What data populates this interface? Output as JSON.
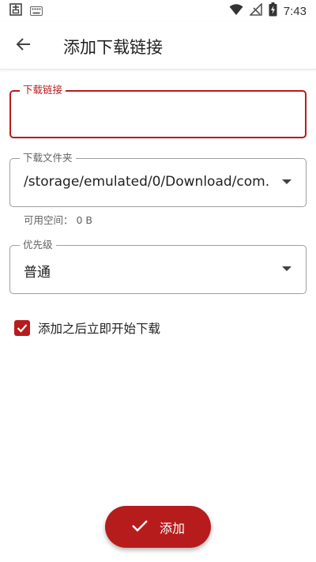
{
  "status_bar": {
    "time": "7:43",
    "icons": [
      "notification-app-icon",
      "keyboard-icon",
      "wifi-icon",
      "no-signal-icon",
      "battery-charging-icon"
    ]
  },
  "toolbar": {
    "title": "添加下载链接",
    "back_icon": "arrow-back-icon"
  },
  "url_field": {
    "label": "下载链接",
    "value": "",
    "placeholder": ""
  },
  "folder_field": {
    "label": "下载文件夹",
    "value": "/storage/emulated/0/Download/com."
  },
  "free_space": "可用空间：  0 B",
  "priority_field": {
    "label": "优先级",
    "value": "普通"
  },
  "start_checkbox": {
    "label": "添加之后立即开始下载",
    "checked": true
  },
  "add_button": {
    "label": "添加",
    "icon": "check-icon"
  },
  "colors": {
    "accent": "#b71c1c",
    "text": "#212121",
    "secondary_text": "#616161",
    "outline": "#9e9e9e"
  }
}
